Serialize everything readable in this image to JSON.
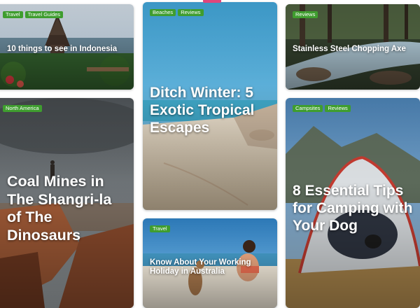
{
  "cards": [
    {
      "id": "indonesia",
      "tags": [
        "Travel",
        "Travel Guides"
      ],
      "title": "10 things to see in Indonesia"
    },
    {
      "id": "ditch-winter",
      "tags": [
        "Beaches",
        "Reviews"
      ],
      "title": "Ditch Winter: 5 Exotic Tropical Escapes"
    },
    {
      "id": "chopping-axe",
      "tags": [
        "Reviews"
      ],
      "title": "Stainless Steel Chopping Axe"
    },
    {
      "id": "coal-mines",
      "tags": [
        "North America"
      ],
      "title": "Coal Mines in The Shangri-la of The Dinosaurs"
    },
    {
      "id": "camping-dog",
      "tags": [
        "Campsites",
        "Reviews"
      ],
      "title": "8 Essential Tips for Camping with Your Dog"
    },
    {
      "id": "working-holiday",
      "tags": [
        "Travel"
      ],
      "title": "Know About Your Working Holiday in Australia"
    }
  ],
  "colors": {
    "tag_bg": "#3f9d2f",
    "accent": "#e0457b"
  }
}
